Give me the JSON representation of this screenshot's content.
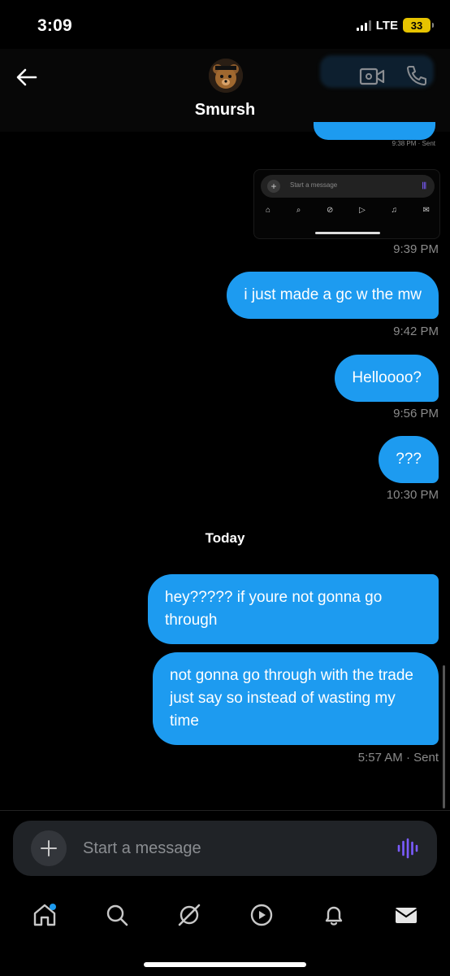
{
  "status_bar": {
    "time": "3:09",
    "network": "LTE",
    "battery": "33"
  },
  "header": {
    "contact_name": "Smursh"
  },
  "messages": {
    "partial_time": "9:38 PM · Sent",
    "screenshot": {
      "placeholder": "Start a message"
    },
    "items": [
      {
        "text": "i just made a gc w the mw",
        "time": "9:42 PM"
      },
      {
        "text": "Helloooo?",
        "time": "9:56 PM"
      },
      {
        "text": "???",
        "time": "10:30 PM"
      }
    ],
    "screenshot_time": "9:39 PM",
    "day_separator": "Today",
    "today": [
      {
        "text": "hey????? if youre not gonna go through"
      },
      {
        "text": "not gonna go through with the trade just say so instead of wasting my time"
      }
    ],
    "last_time": "5:57 AM · Sent"
  },
  "compose": {
    "placeholder": "Start a message"
  },
  "tabbar": {
    "items": [
      "home-icon",
      "search-icon",
      "grok-icon",
      "video-icon",
      "notifications-icon",
      "messages-icon"
    ]
  },
  "colors": {
    "accent": "#1d9bf0",
    "background": "#000000",
    "voice": "#7b5cff"
  }
}
